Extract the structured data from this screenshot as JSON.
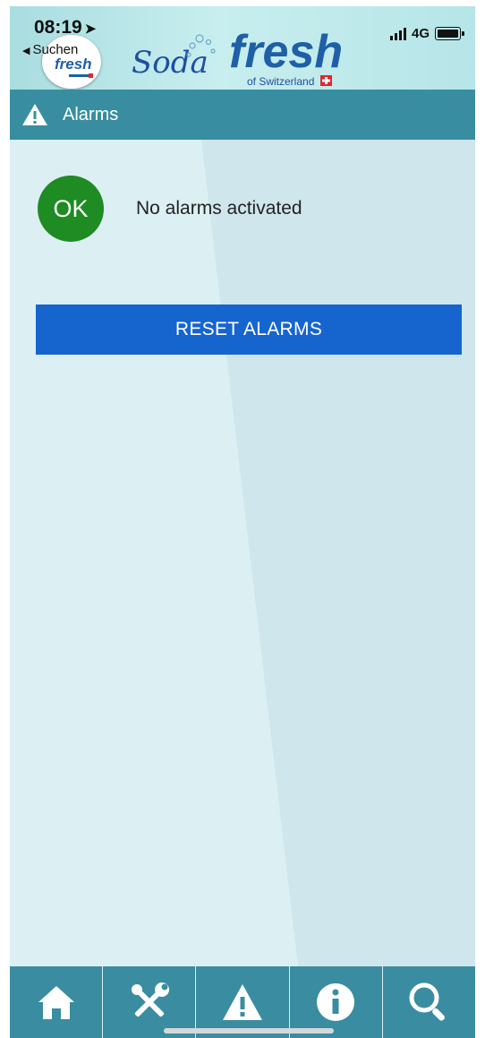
{
  "status": {
    "time": "08:19",
    "location_icon": "location-arrow-icon",
    "network": "4G",
    "back_label": "Suchen"
  },
  "brand": {
    "small_logo_text": "fresh",
    "soda_text": "Soda",
    "fresh_text": "fresh",
    "tagline": "of Switzerland"
  },
  "title_bar": {
    "icon": "warning-icon",
    "title": "Alarms"
  },
  "alarm_status": {
    "badge": "OK",
    "message": "No alarms activated",
    "badge_color": "#1e8b23"
  },
  "actions": {
    "reset_label": "RESET ALARMS",
    "reset_color": "#1665cf"
  },
  "tabbar": {
    "items": [
      {
        "icon": "home-icon"
      },
      {
        "icon": "tools-icon"
      },
      {
        "icon": "warning-icon"
      },
      {
        "icon": "info-icon"
      },
      {
        "icon": "search-icon"
      }
    ]
  },
  "colors": {
    "header_bar": "#388ea0",
    "tabbar": "#3a8da0",
    "background": "#dcf0f4"
  }
}
